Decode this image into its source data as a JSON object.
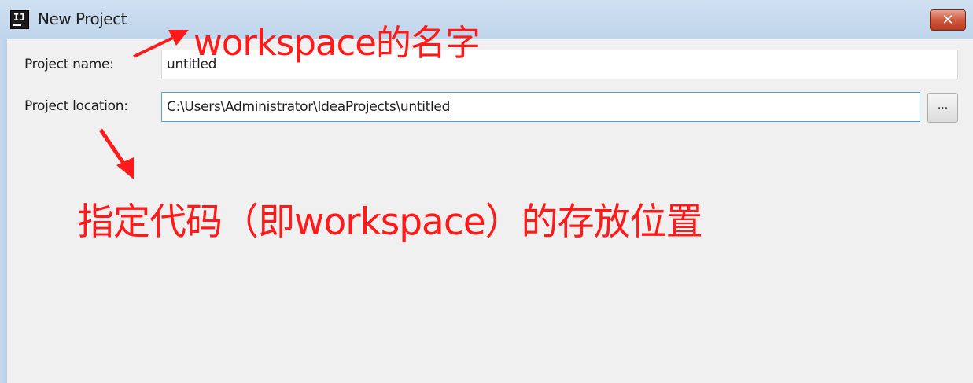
{
  "window": {
    "title": "New Project",
    "close_symbol": "✕"
  },
  "form": {
    "project_name_label": "Project name:",
    "project_name_value": "untitled",
    "project_location_label": "Project location:",
    "project_location_value": "C:\\Users\\Administrator\\IdeaProjects\\untitled",
    "browse_label": "..."
  },
  "annotations": {
    "top": "workspace的名字",
    "bottom": "指定代码（即workspace）的存放位置",
    "color": "#ff1a1a"
  },
  "icons": {
    "app": "intellij-idea-icon",
    "close": "close-icon",
    "arrow": "red-arrow-icon"
  }
}
